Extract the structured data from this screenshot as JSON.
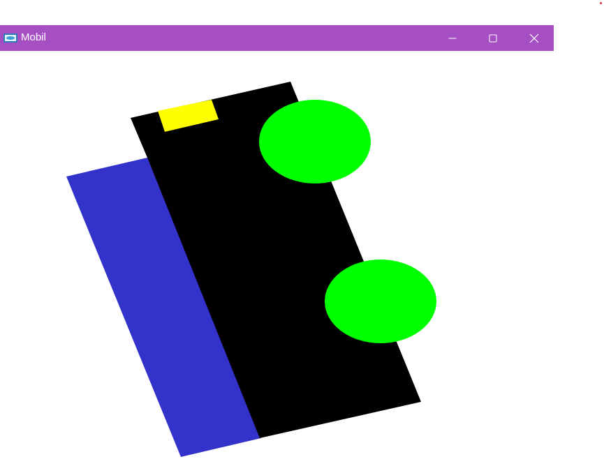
{
  "window": {
    "title": "Mobil",
    "titlebar_color": "#a64fc3",
    "controls": {
      "minimize_icon": "minimize-icon",
      "maximize_icon": "maximize-icon",
      "close_icon": "close-icon"
    }
  },
  "scene": {
    "background": "#ffffff",
    "car_body_color": "#000000",
    "side_panel_color": "#3333cc",
    "window_color": "#ffff00",
    "wheel_color": "#00ff00",
    "wheel_count": 2
  }
}
